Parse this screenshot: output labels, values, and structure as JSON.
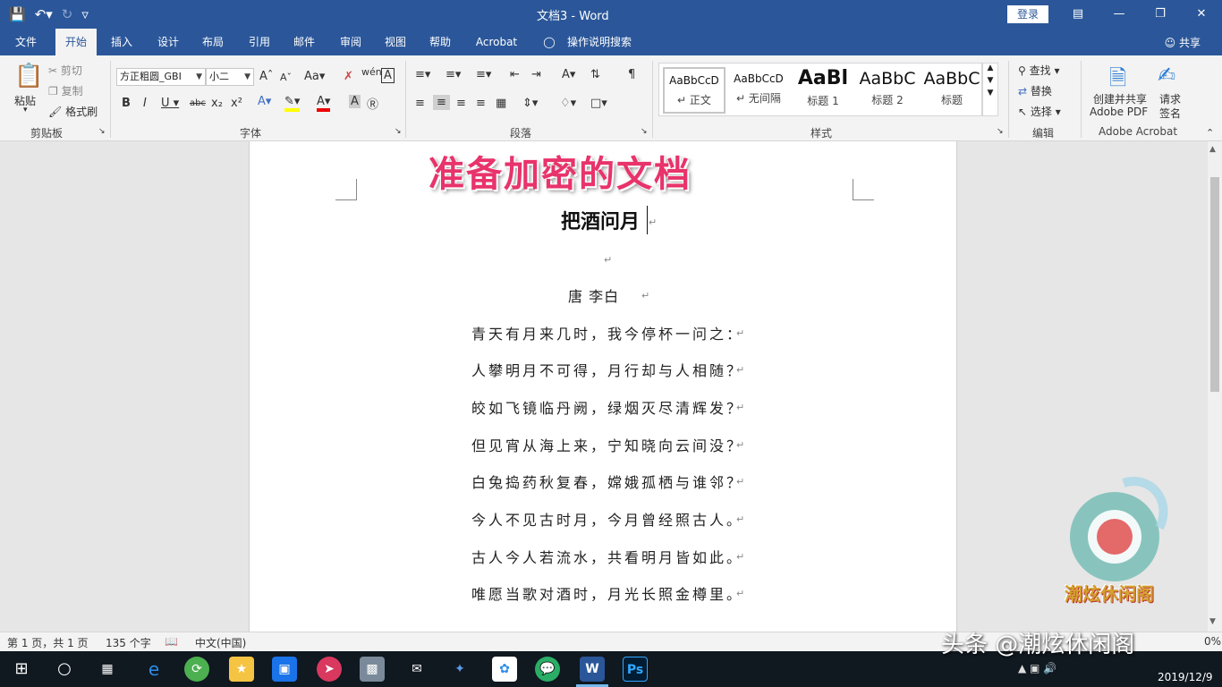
{
  "window": {
    "title": "文档3  -  Word",
    "login": "登录"
  },
  "tabs": [
    "文件",
    "开始",
    "插入",
    "设计",
    "布局",
    "引用",
    "邮件",
    "审阅",
    "视图",
    "帮助",
    "Acrobat",
    "操作说明搜索"
  ],
  "share": "共享",
  "clipboard": {
    "paste": "粘贴",
    "cut": "剪切",
    "copy": "复制",
    "format_painter": "格式刷",
    "label": "剪贴板"
  },
  "font": {
    "family": "方正粗圆_GBI",
    "size": "小二",
    "label": "字体",
    "aa": "Aa",
    "wen": "wén"
  },
  "paragraph": {
    "label": "段落"
  },
  "styles": {
    "label": "样式",
    "items": [
      {
        "sample": "AaBbCcD",
        "name": "正文"
      },
      {
        "sample": "AaBbCcD",
        "name": "无间隔"
      },
      {
        "sample": "AaBl",
        "name": "标题 1"
      },
      {
        "sample": "AaBbC",
        "name": "标题 2"
      },
      {
        "sample": "AaBbC",
        "name": "标题"
      }
    ]
  },
  "editing": {
    "find": "查找",
    "replace": "替换",
    "select": "选择",
    "label": "编辑"
  },
  "acrobat": {
    "create_share": "创建并共享",
    "adobe_pdf": "Adobe PDF",
    "request_sign_1": "请求",
    "request_sign_2": "签名",
    "label": "Adobe Acrobat"
  },
  "document": {
    "overlay_caption": "准备加密的文档",
    "title": "把酒问月",
    "author": "唐    李白",
    "lines": [
      "青天有月来几时，我今停杯一问之：",
      "人攀明月不可得，月行却与人相随？",
      "皎如飞镜临丹阙，绿烟灭尽清辉发？",
      "但见宵从海上来，宁知晓向云间没？",
      "白兔捣药秋复春，嫦娥孤栖与谁邻？",
      "今人不见古时月，今月曾经照古人。",
      "古人今人若流水，共看明月皆如此。",
      "唯愿当歌对酒时，月光长照金樽里。"
    ]
  },
  "status": {
    "page": "第 1 页，共 1 页",
    "words": "135 个字",
    "language": "中文(中国)",
    "zoom": "0%"
  },
  "taskbar": {
    "date": "2019/12/9"
  },
  "watermarks": {
    "toutiao": "头条 @潮炫休闲阁",
    "logo_text": "潮炫休闲阁"
  }
}
